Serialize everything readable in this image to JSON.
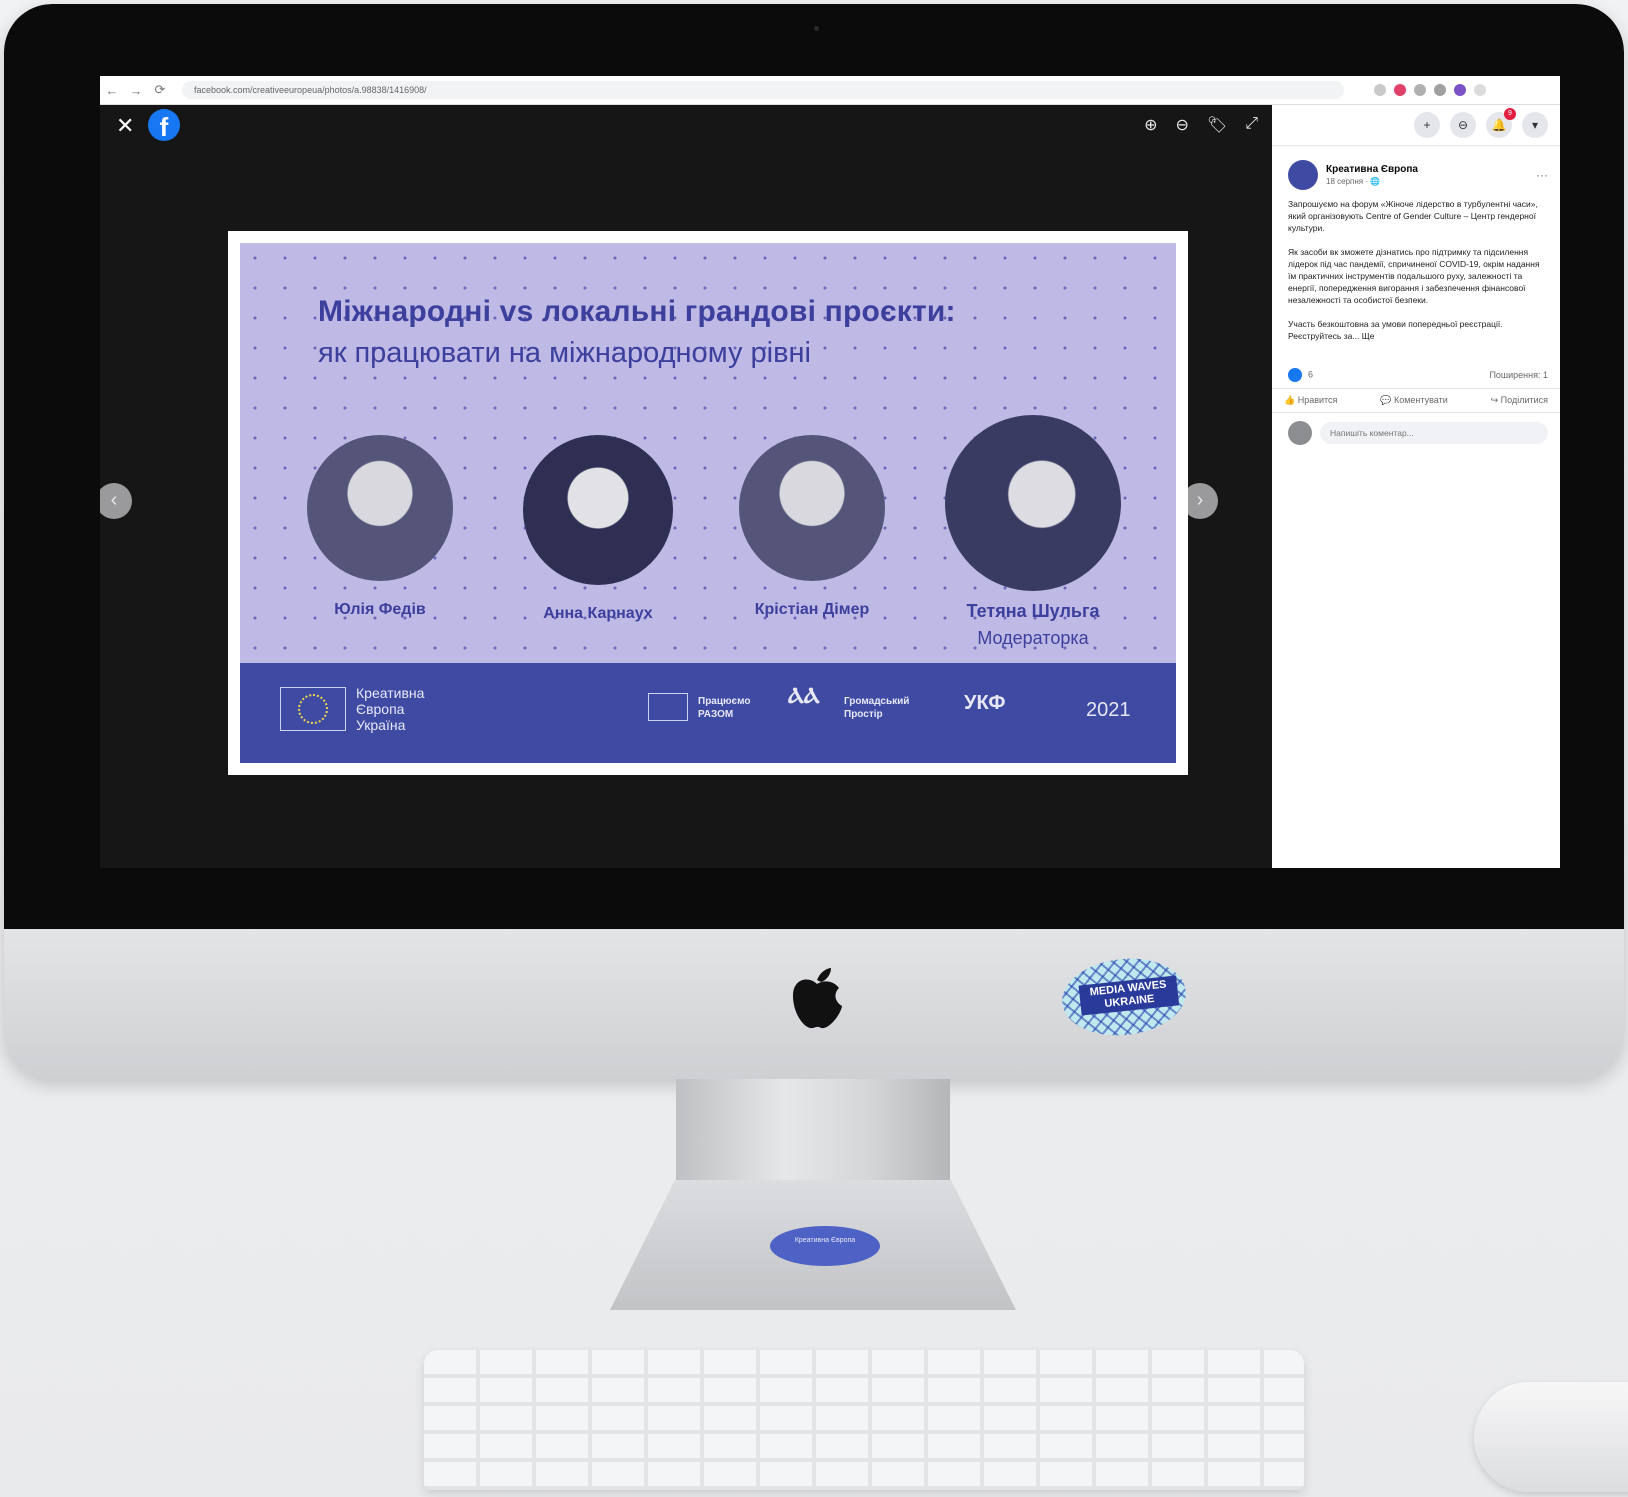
{
  "browser": {
    "url": "facebook.com/creativeeuropeua/photos/a.98838/1416908/",
    "colors": {
      "bar": "#ffffff",
      "url_bg": "#f1f3f4"
    }
  },
  "viewer": {
    "close_glyph": "✕",
    "logo_glyph": "f",
    "tools": [
      "zoom-in-icon",
      "zoom-out-icon",
      "tag-icon",
      "fullscreen-icon"
    ],
    "prev_glyph": "‹",
    "next_glyph": "›"
  },
  "poster": {
    "title": "Міжнародні vs локальні грандові проєкти:",
    "subtitle": "як працювати на міжнародному рівні",
    "speakers": [
      {
        "name": "Юлія Федів",
        "role": ""
      },
      {
        "name": "Анна Карнаух",
        "role": ""
      },
      {
        "name": "Крістіан Дімер",
        "role": ""
      },
      {
        "name": "Тетяна Шульга",
        "role": "Модераторка"
      }
    ],
    "footer": {
      "brand_line1": "Креативна",
      "brand_line2": "Європа",
      "brand_line3": "Україна",
      "partner1_line1": "Працюємо",
      "partner1_line2": "РАЗОМ",
      "partner2_line1": "Громадський",
      "partner2_line2": "Простір",
      "partner3": "УКФ",
      "year": "2021"
    },
    "colors": {
      "accent": "#3c3f9c",
      "bg": "#bfb9e6",
      "footer": "#3f4aa2"
    }
  },
  "side_panel": {
    "top_icons": [
      "+",
      "⊖",
      "🔔",
      "▾"
    ],
    "notification_count": "9",
    "page_name": "Креативна Європа",
    "post_date": "18 серпня · 🌐",
    "more_glyph": "···",
    "paragraphs": [
      "Запрошуємо на форум «Жіноче лідерство в турбулентні часи», який організовують Centre of Gender Culture – Центр гендерної культури.",
      "Як засоби вк зможете дізнатись про підтримку та підсилення лідерок під час пандемії, спричиненої COVID-19, окрім надання їм практичних інструментів подальшого руху, залежності та енергії, попередження вигорання і забезпечення фінансової незалежності та особистої безпеки.",
      "Участь безкоштовна за умови попередньої реєстрації. Реєструйтесь за... Ще"
    ],
    "reactions_count": "6",
    "shares": "Поширення: 1",
    "actions": [
      "👍 Нравится",
      "💬 Коментувати",
      "↪ Поділитися"
    ],
    "comment_placeholder": "Напишіть коментар..."
  },
  "stickers": {
    "chin_text": "MEDIA WAVES UKRAINE",
    "foot_text": "Креативна Європа"
  }
}
